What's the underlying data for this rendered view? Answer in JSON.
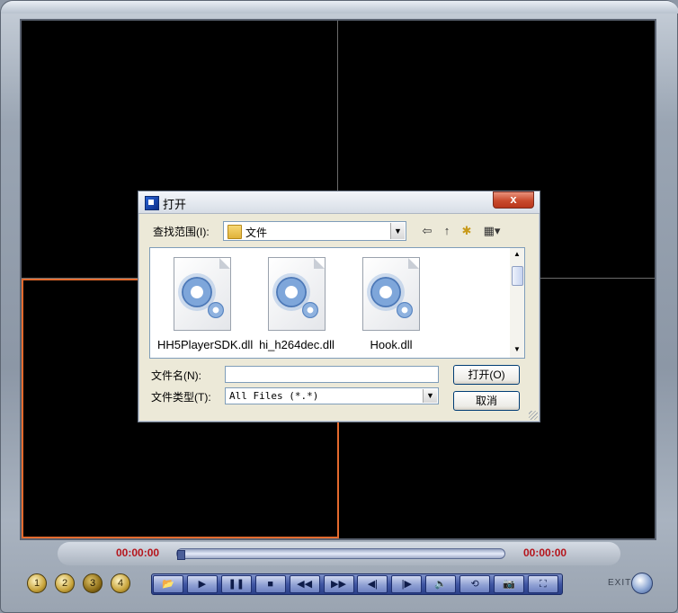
{
  "dialog": {
    "title": "打开",
    "close_label": "x",
    "look_in_label": "查找范围(I):",
    "look_in_value": "文件",
    "toolbar": {
      "back_icon": "⇦",
      "up_icon": "↑",
      "newfolder_icon": "✱",
      "views_icon": "▦▾"
    },
    "files": [
      {
        "name": "HH5PlayerSDK.dll"
      },
      {
        "name": "hi_h264dec.dll"
      },
      {
        "name": "Hook.dll"
      }
    ],
    "file_name_label": "文件名(N):",
    "file_name_value": "",
    "file_type_label": "文件类型(T):",
    "file_type_value": "All Files (*.*)",
    "open_button": "打开(O)",
    "cancel_button": "取消"
  },
  "player": {
    "time_left": "00:00:00",
    "time_right": "00:00:00",
    "progress": 0,
    "layout_buttons": [
      "1",
      "2",
      "3",
      "4"
    ],
    "selected_layout": "3",
    "controls": [
      {
        "name": "open-file-icon",
        "glyph": "📂"
      },
      {
        "name": "play-icon",
        "glyph": "▶"
      },
      {
        "name": "pause-icon",
        "glyph": "❚❚"
      },
      {
        "name": "stop-icon",
        "glyph": "■"
      },
      {
        "name": "rewind-icon",
        "glyph": "◀◀"
      },
      {
        "name": "fast-forward-icon",
        "glyph": "▶▶"
      },
      {
        "name": "step-back-icon",
        "glyph": "◀|"
      },
      {
        "name": "step-forward-icon",
        "glyph": "|▶"
      },
      {
        "name": "sound-icon",
        "glyph": "🔈"
      },
      {
        "name": "loop-icon",
        "glyph": "⟲"
      },
      {
        "name": "snapshot-icon",
        "glyph": "📷"
      },
      {
        "name": "fullscreen-icon",
        "glyph": "⛶"
      }
    ],
    "exit_label": "EXIT"
  }
}
